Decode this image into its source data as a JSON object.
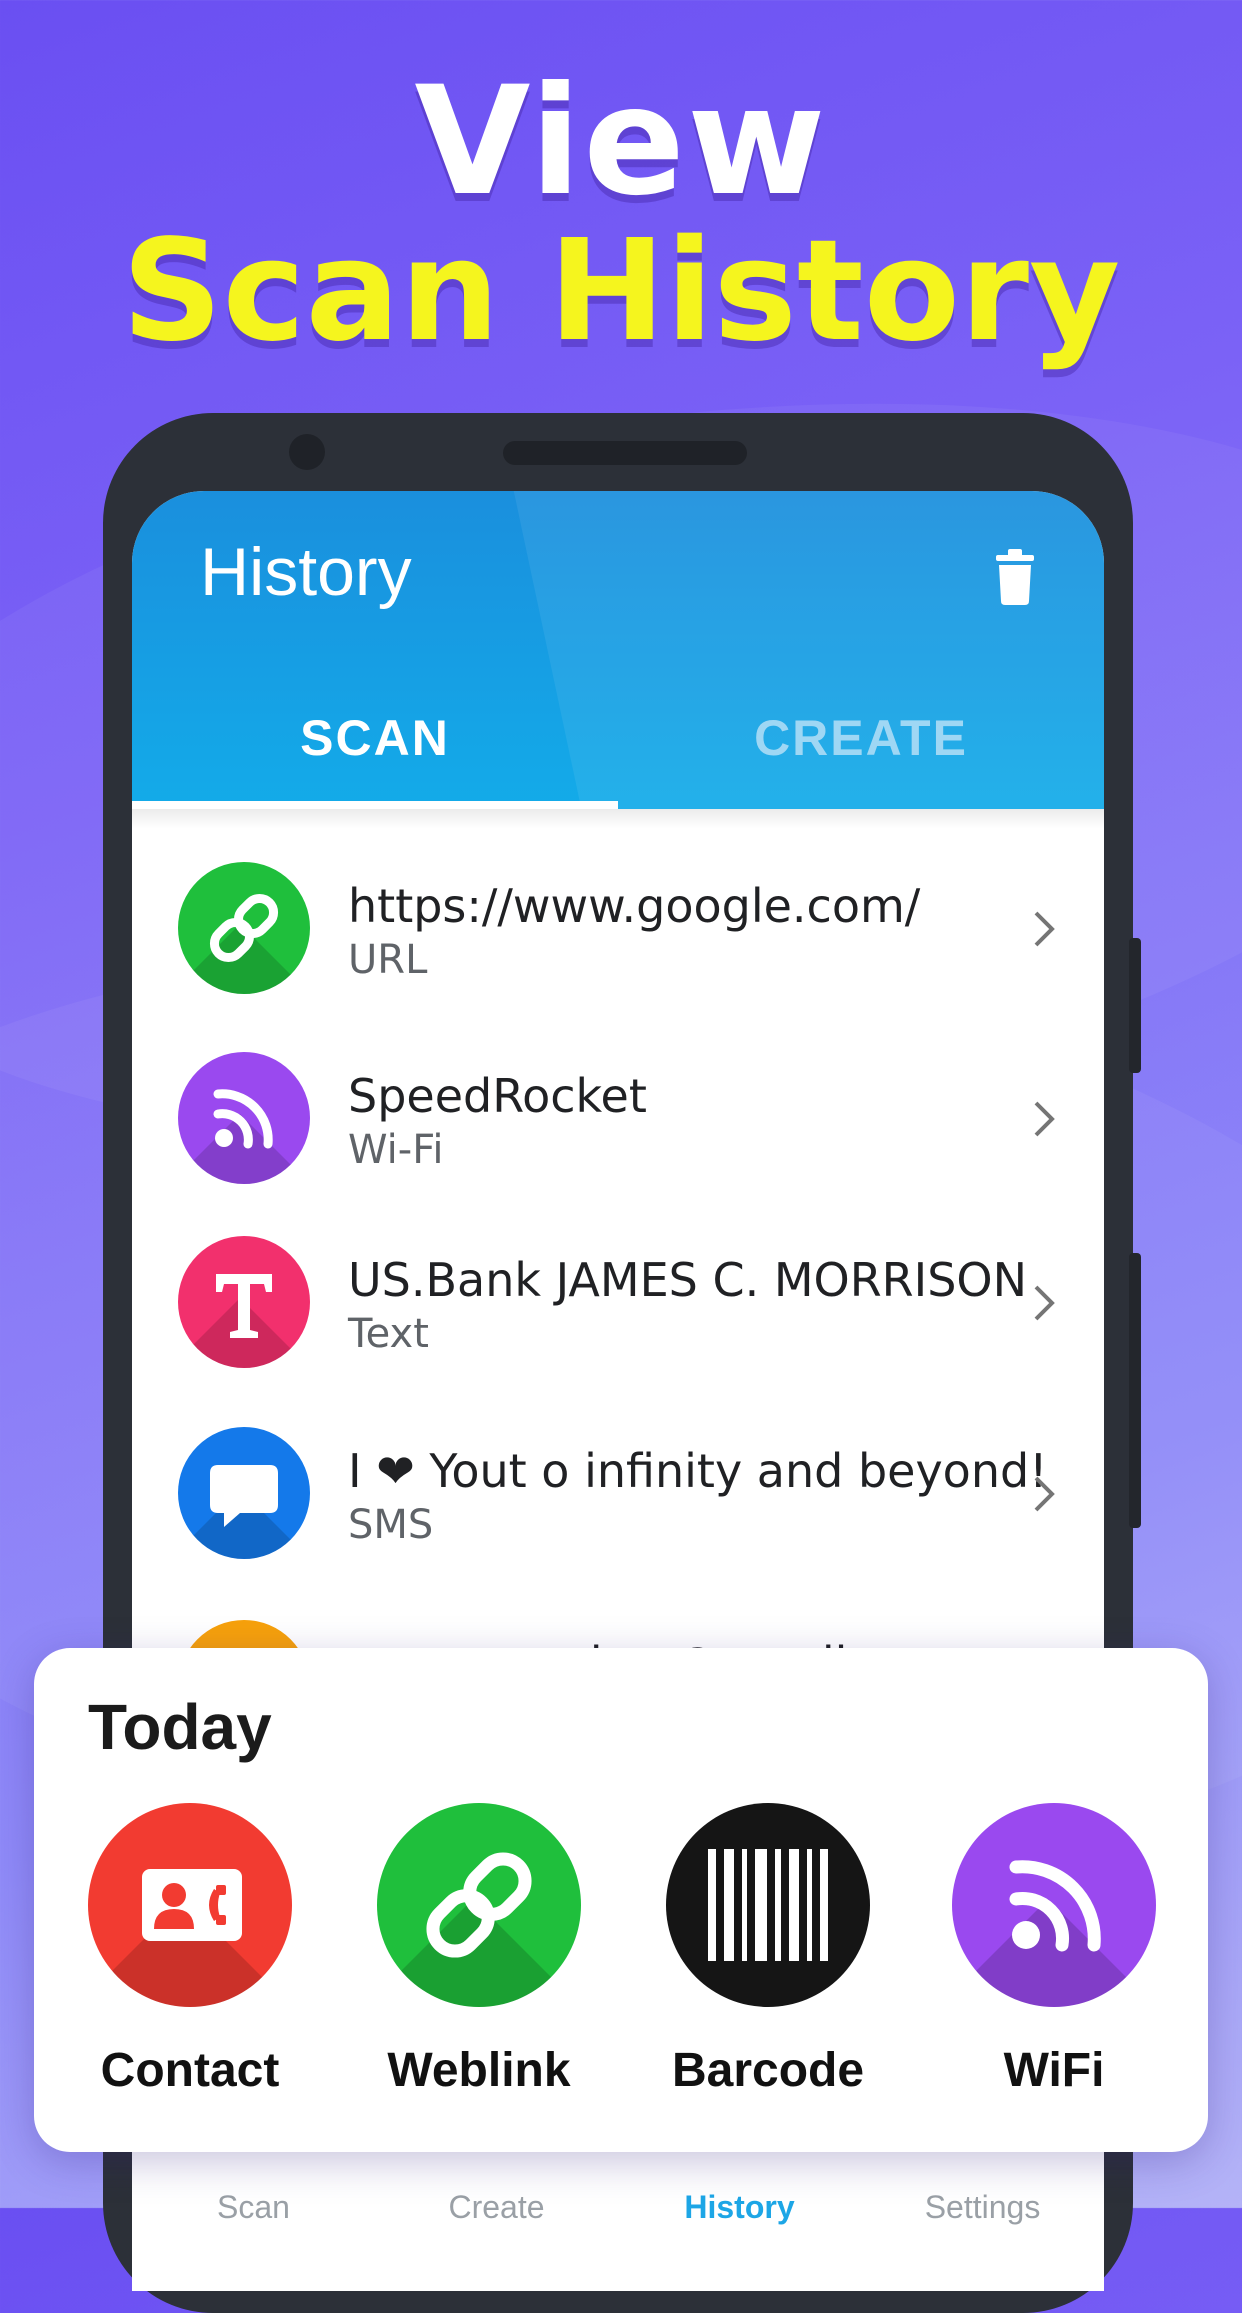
{
  "promo": {
    "line1": "View",
    "line2": "Scan History"
  },
  "appbar": {
    "title": "History",
    "delete_icon": "trash-icon"
  },
  "tabs": [
    {
      "label": "SCAN",
      "active": true
    },
    {
      "label": "CREATE",
      "active": false
    }
  ],
  "history": [
    {
      "title": "https://www.google.com/",
      "type": "URL",
      "icon": "link-icon",
      "color": "#1fbf3c"
    },
    {
      "title": "SpeedRocket",
      "type": "Wi-Fi",
      "icon": "wifi-icon",
      "color": "#9a49ef"
    },
    {
      "title": "US.Bank JAMES C. MORRISON",
      "type": "Text",
      "icon": "text-icon",
      "color": "#f2306d"
    },
    {
      "title": "I ❤ Yout o infinity and beyond!",
      "type": "SMS",
      "icon": "sms-icon",
      "color": "#1479ea"
    },
    {
      "title": "annesaunders@gmail.com",
      "type": "",
      "icon": "email-icon",
      "color": "#f7a10b"
    }
  ],
  "bottom_nav": [
    {
      "label": "Scan",
      "active": false
    },
    {
      "label": "Create",
      "active": false
    },
    {
      "label": "History",
      "active": true
    },
    {
      "label": "Settings",
      "active": false
    }
  ],
  "today": {
    "title": "Today",
    "items": [
      {
        "label": "Contact",
        "icon": "contact-icon",
        "color": "#f23b31"
      },
      {
        "label": "Weblink",
        "icon": "link-icon",
        "color": "#1fbf3c"
      },
      {
        "label": "Barcode",
        "icon": "barcode-icon",
        "color": "#151515"
      },
      {
        "label": "WiFi",
        "icon": "wifi-icon",
        "color": "#9a49ef"
      }
    ]
  }
}
